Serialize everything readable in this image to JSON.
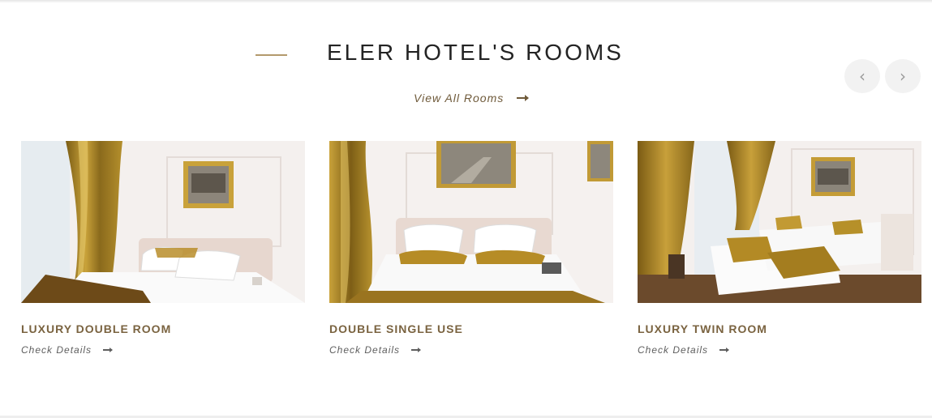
{
  "section": {
    "title": "ELER HOTEL'S ROOMS",
    "view_all_label": "View All Rooms",
    "nav": {
      "prev_icon": "chevron-left-icon",
      "next_icon": "chevron-right-icon"
    }
  },
  "rooms": [
    {
      "name": "LUXURY DOUBLE ROOM",
      "details_label": "Check Details"
    },
    {
      "name": "DOUBLE SINGLE USE",
      "details_label": "Check Details"
    },
    {
      "name": "LUXURY TWIN ROOM",
      "details_label": "Check Details"
    }
  ],
  "colors": {
    "accent": "#b39a6c",
    "room_title": "#7a6340",
    "heading": "#232323",
    "curtain_gold": "#9a7a22",
    "wall": "#f3eeeb"
  }
}
